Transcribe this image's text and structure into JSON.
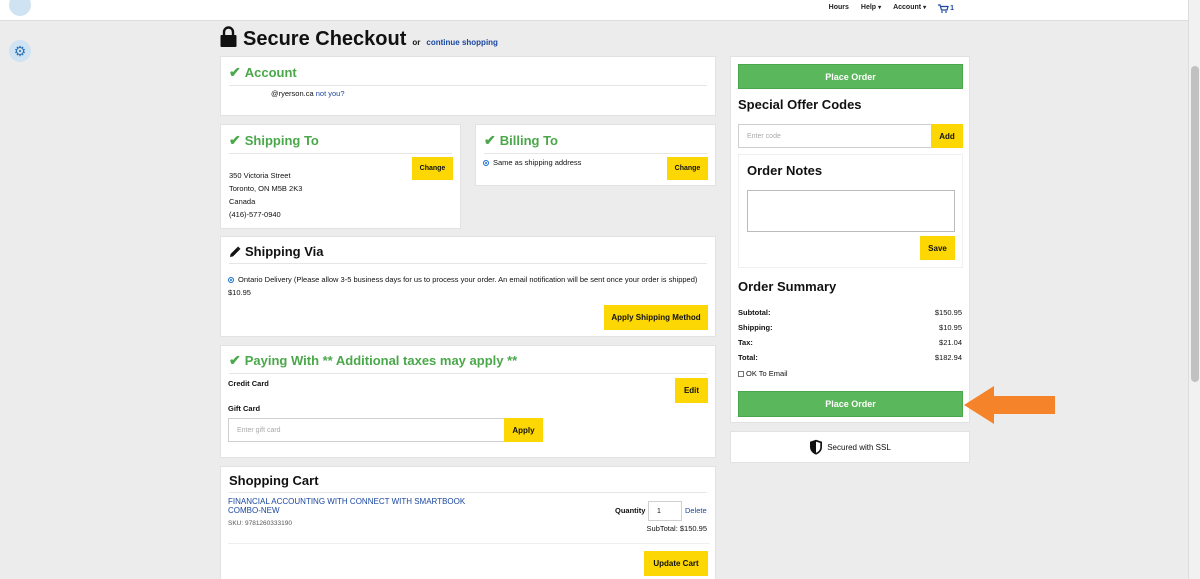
{
  "topnav": {
    "hours": "Hours",
    "help": "Help",
    "account": "Account",
    "cart_count": "1"
  },
  "page": {
    "title": "Secure Checkout",
    "or": "or",
    "continue_shopping": "continue shopping"
  },
  "account": {
    "heading": "Account",
    "email": "@ryerson.ca",
    "not_you": "not you?"
  },
  "shipping_to": {
    "heading": "Shipping To",
    "lines": [
      "350 Victoria Street",
      "Toronto, ON M5B 2K3",
      "Canada",
      "(416)-577-0940"
    ],
    "change": "Change"
  },
  "billing_to": {
    "heading": "Billing To",
    "option": "Same as shipping address",
    "change": "Change"
  },
  "shipping_via": {
    "heading": "Shipping Via",
    "option": "Ontario Delivery (Please allow 3-5 business days for us to process your order. An email notification will be sent once your order is shipped) $10.95",
    "apply": "Apply Shipping Method"
  },
  "paying_with": {
    "heading": "Paying With ** Additional taxes may apply **",
    "credit_card": "Credit Card",
    "edit": "Edit",
    "gift_card": "Gift Card",
    "gift_placeholder": "Enter gift card",
    "apply": "Apply"
  },
  "cart": {
    "heading": "Shopping Cart",
    "item_title": "FINANCIAL ACCOUNTING WITH CONNECT WITH SMARTBOOK COMBO-NEW",
    "sku": "SKU: 9781260333190",
    "quantity_label": "Quantity",
    "quantity": "1",
    "delete": "Delete",
    "subtotal": "SubTotal: $150.95",
    "update": "Update Cart"
  },
  "sidebar": {
    "place_order": "Place Order",
    "offer_heading": "Special Offer Codes",
    "code_placeholder": "Enter code",
    "add": "Add",
    "notes_heading": "Order Notes",
    "save": "Save",
    "summary_heading": "Order Summary",
    "rows": [
      {
        "label": "Subtotal:",
        "value": "$150.95"
      },
      {
        "label": "Shipping:",
        "value": "$10.95"
      },
      {
        "label": "Tax:",
        "value": "$21.04"
      },
      {
        "label": "Total:",
        "value": "$182.94"
      }
    ],
    "ok_email": "OK To Email",
    "ssl": "Secured with SSL"
  },
  "colors": {
    "green": "#5bb75b",
    "yellow": "#fcd703",
    "link": "#1a47a0",
    "arrow": "#f5832a"
  }
}
